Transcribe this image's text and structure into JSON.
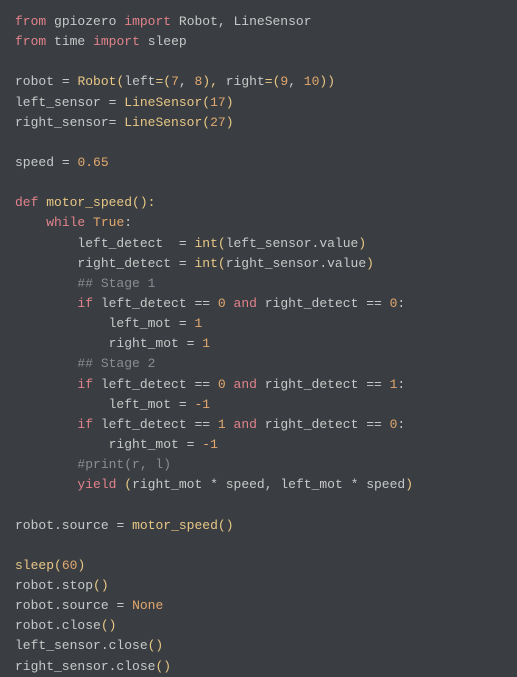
{
  "code": {
    "l1_from": "from",
    "l1_mod": "gpiozero",
    "l1_import": "import",
    "l1_names": "Robot, LineSensor",
    "l2_from": "from",
    "l2_mod": "time",
    "l2_import": "import",
    "l2_names": "sleep",
    "l4_robot": "robot",
    "l4_eq": "=",
    "l4_Robot": "Robot",
    "l4_lp": "(",
    "l4_left": "left",
    "l4_eq2": "=(",
    "l4_n7": "7",
    "l4_c1": ", ",
    "l4_n8": "8",
    "l4_rp1": "), ",
    "l4_right": "right",
    "l4_eq3": "=(",
    "l4_n9": "9",
    "l4_c2": ", ",
    "l4_n10": "10",
    "l4_rp2": "))",
    "l5_ls": "left_sensor",
    "l5_eq": "=",
    "l5_LS": "LineSensor",
    "l5_lp": "(",
    "l5_n": "17",
    "l5_rp": ")",
    "l6_rs": "right_sensor",
    "l6_eq": "=",
    "l6_LS": "LineSensor",
    "l6_lp": "(",
    "l6_n": "27",
    "l6_rp": ")",
    "l8_speed": "speed",
    "l8_eq": "=",
    "l8_val": "0.65",
    "l10_def": "def",
    "l10_fn": "motor_speed",
    "l10_pr": "():",
    "l11_while": "while",
    "l11_true": "True",
    "l11_colon": ":",
    "l12_ld": "left_detect",
    "l12_eq": "=",
    "l12_int": "int",
    "l12_lp": "(",
    "l12_lsv": "left_sensor.value",
    "l12_rp": ")",
    "l13_rd": "right_detect",
    "l13_eq": "=",
    "l13_int": "int",
    "l13_lp": "(",
    "l13_rsv": "right_sensor.value",
    "l13_rp": ")",
    "l14_c": "## Stage 1",
    "l15_if": "if",
    "l15_ld": "left_detect",
    "l15_eq": "==",
    "l15_z1": "0",
    "l15_and": "and",
    "l15_rd": "right_detect",
    "l15_eq2": "==",
    "l15_z2": "0",
    "l15_colon": ":",
    "l16_lm": "left_mot",
    "l16_eq": "=",
    "l16_v": "1",
    "l17_rm": "right_mot",
    "l17_eq": "=",
    "l17_v": "1",
    "l18_c": "## Stage 2",
    "l19_if": "if",
    "l19_ld": "left_detect",
    "l19_eq": "==",
    "l19_z": "0",
    "l19_and": "and",
    "l19_rd": "right_detect",
    "l19_eq2": "==",
    "l19_one": "1",
    "l19_colon": ":",
    "l20_lm": "left_mot",
    "l20_eq": "=",
    "l20_v": "-1",
    "l21_if": "if",
    "l21_ld": "left_detect",
    "l21_eq": "==",
    "l21_one": "1",
    "l21_and": "and",
    "l21_rd": "right_detect",
    "l21_eq2": "==",
    "l21_z": "0",
    "l21_colon": ":",
    "l22_rm": "right_mot",
    "l22_eq": "=",
    "l22_v": "-1",
    "l23_c": "#print(r, l)",
    "l24_yield": "yield",
    "l24_lp": "(",
    "l24_rm": "right_mot",
    "l24_mul": "*",
    "l24_sp1": "speed",
    "l24_c": ", ",
    "l24_lm": "left_mot",
    "l24_mul2": "*",
    "l24_sp2": "speed",
    "l24_rp": ")",
    "l26_rs": "robot.source",
    "l26_eq": "=",
    "l26_fn": "motor_speed",
    "l26_pr": "()",
    "l28_sleep": "sleep",
    "l28_lp": "(",
    "l28_n": "60",
    "l28_rp": ")",
    "l29": "robot.stop",
    "l29_pr": "()",
    "l30_rs": "robot.source",
    "l30_eq": "=",
    "l30_none": "None",
    "l31": "robot.close",
    "l31_pr": "()",
    "l32": "left_sensor.close",
    "l32_pr": "()",
    "l33": "right_sensor.close",
    "l33_pr": "()"
  }
}
